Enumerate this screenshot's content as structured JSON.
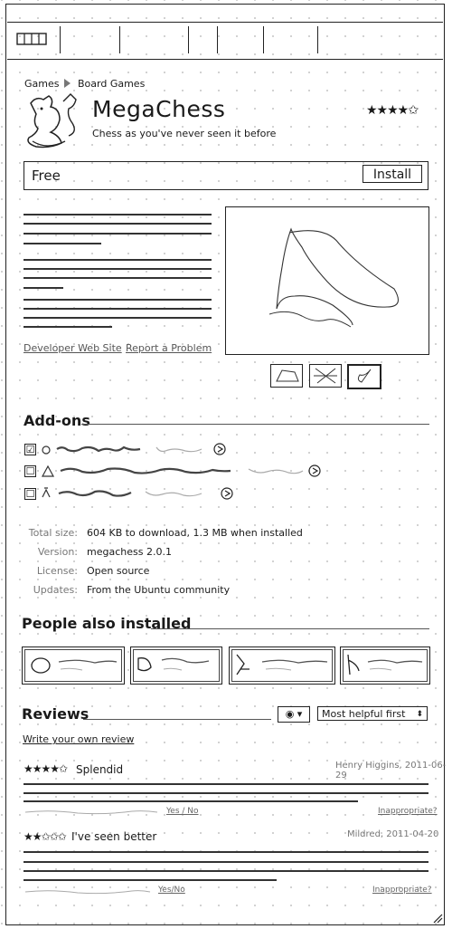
{
  "breadcrumb": {
    "root": "Games",
    "current": "Board Games"
  },
  "app": {
    "name": "MegaChess",
    "subtitle": "Chess as you've never seen it before",
    "rating": "★★★★✩",
    "price": "Free",
    "install_label": "Install"
  },
  "links": {
    "developer": "Developer Web Site",
    "report": "Report a Problem"
  },
  "addons": {
    "title": "Add-ons",
    "items": [
      {
        "checked": true,
        "check": "☑"
      },
      {
        "checked": false,
        "check": "☐"
      },
      {
        "checked": false,
        "check": "☐"
      }
    ]
  },
  "details": {
    "total_size_label": "Total size:",
    "total_size": "604 KB to download, 1.3 MB when installed",
    "version_label": "Version:",
    "version": "megachess 2.0.1",
    "license_label": "License:",
    "license": "Open source",
    "updates_label": "Updates:",
    "updates": "From the Ubuntu community"
  },
  "also_installed": {
    "title": "People also installed"
  },
  "reviews": {
    "title": "Reviews",
    "language_icon": "◉ ▾",
    "sort": "Most helpful first",
    "write_link": "Write your own review",
    "items": [
      {
        "stars": "★★★★✩",
        "title": "Splendid",
        "author": "Henry Higgins, 2011-06-29",
        "useful": "Yes / No",
        "flag": "Inappropriate?"
      },
      {
        "stars": "★★✩✩✩",
        "title": "I've seen better",
        "author": "Mildred, 2011-04-20",
        "useful": "Yes/No",
        "flag": "Inappropriate?"
      }
    ]
  }
}
